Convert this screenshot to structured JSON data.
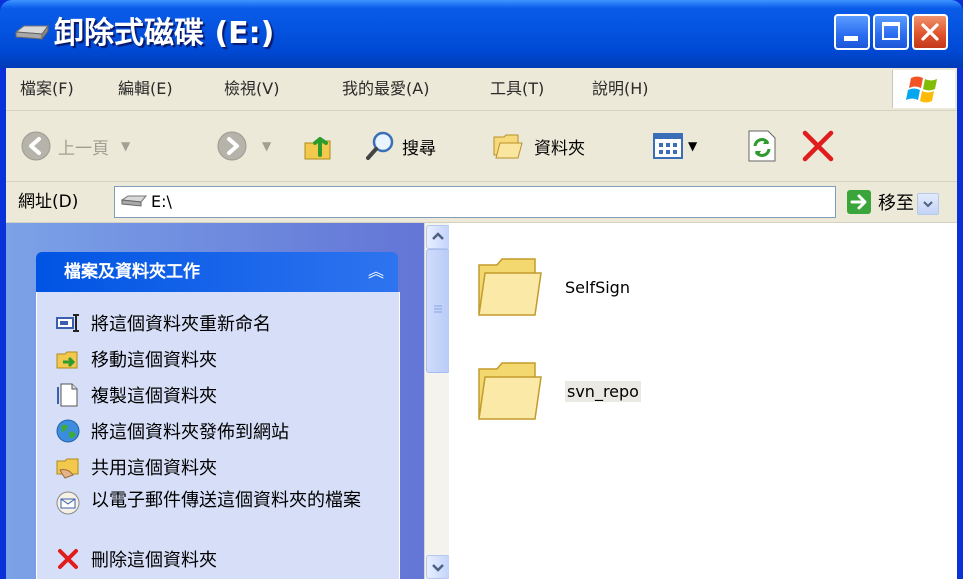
{
  "window": {
    "title": "卸除式磁碟 (E:)"
  },
  "menu": {
    "items": [
      "檔案(F)",
      "編輯(E)",
      "檢視(V)",
      "我的最愛(A)",
      "工具(T)",
      "說明(H)"
    ]
  },
  "toolbar": {
    "back_label": "上一頁",
    "search_label": "搜尋",
    "folders_label": "資料夾"
  },
  "address": {
    "label": "網址(D)",
    "value": "E:\\",
    "go_label": "移至"
  },
  "task_pane": {
    "title": "檔案及資料夾工作",
    "tasks": [
      {
        "label": "將這個資料夾重新命名",
        "icon": "rename-icon"
      },
      {
        "label": "移動這個資料夾",
        "icon": "move-icon"
      },
      {
        "label": "複製這個資料夾",
        "icon": "copy-icon"
      },
      {
        "label": "將這個資料夾發佈到網站",
        "icon": "publish-web-icon"
      },
      {
        "label": "共用這個資料夾",
        "icon": "share-folder-icon"
      },
      {
        "label": "以電子郵件傳送這個資料夾的檔案",
        "icon": "email-icon"
      },
      {
        "label": "刪除這個資料夾",
        "icon": "delete-icon"
      }
    ]
  },
  "files": [
    {
      "name": "SelfSign",
      "icon": "folder-icon",
      "selected": false
    },
    {
      "name": "svn_repo",
      "icon": "folder-icon",
      "selected": true
    }
  ],
  "colors": {
    "titlebar": "#0453e0",
    "close_button": "#e0552c",
    "client_bg": "#ece9d8",
    "task_header": "#0054e3",
    "task_body": "#d6dff7",
    "delete_red": "#e01c1c"
  }
}
